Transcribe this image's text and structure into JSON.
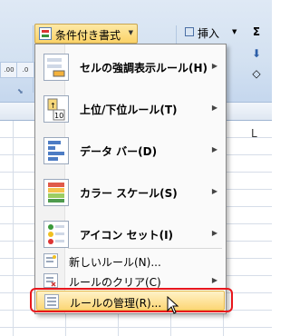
{
  "ribbon": {
    "conditional_formatting_label": "条件付き書式",
    "insert_label": "挿入",
    "number_buttons": [
      ".00",
      ".0"
    ],
    "column_letter": "L"
  },
  "menu": {
    "big_items": [
      {
        "label": "セルの強調表示ルール(H)",
        "icon": "highlight-cells-icon"
      },
      {
        "label": "上位/下位ルール(T)",
        "icon": "top-bottom-icon"
      },
      {
        "label": "データ バー(D)",
        "icon": "data-bar-icon"
      },
      {
        "label": "カラー スケール(S)",
        "icon": "color-scale-icon"
      },
      {
        "label": "アイコン セット(I)",
        "icon": "icon-set-icon"
      }
    ],
    "small_items": [
      {
        "label": "新しいルール(N)...",
        "icon": "new-rule-icon"
      },
      {
        "label": "ルールのクリア(C)",
        "icon": "clear-rules-icon"
      },
      {
        "label": "ルールの管理(R)...",
        "icon": "manage-rules-icon"
      }
    ]
  },
  "colors": {
    "highlight": "#fcd675",
    "callout": "#e8161b"
  }
}
